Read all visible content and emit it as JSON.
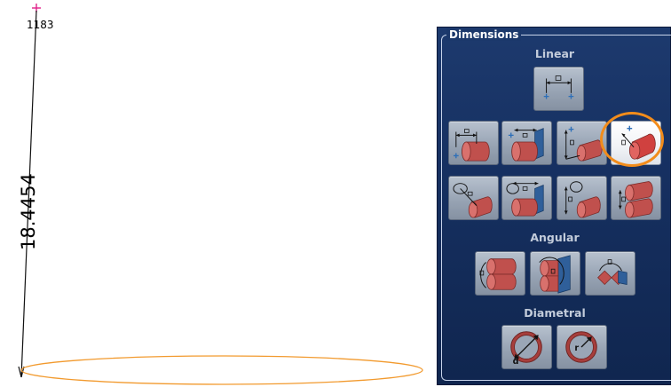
{
  "viewport": {
    "point_label": "1183",
    "dimension_value": "18.4454"
  },
  "panel": {
    "title": "Dimensions",
    "sections": {
      "linear": "Linear",
      "angular": "Angular",
      "diametral": "Diametral"
    }
  },
  "colors": {
    "circle_outline": "#f29a2e",
    "panel_bg": "#163061",
    "highlight": "#f28c1b",
    "point_marker": "#e0218a",
    "cylinder": "#c0504d"
  }
}
